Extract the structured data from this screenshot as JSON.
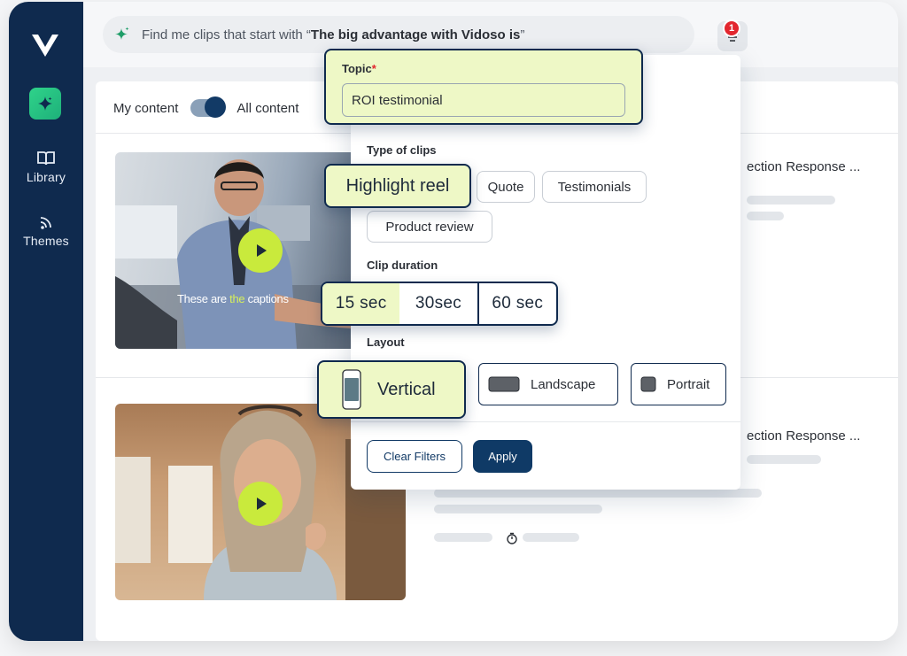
{
  "sidebar": {
    "items": [
      {
        "label": "Library",
        "icon": "book-icon"
      },
      {
        "label": "Themes",
        "icon": "rss-icon"
      }
    ]
  },
  "search": {
    "prefix": "Find me clips that start with “",
    "bold": "The big advantage with Vidoso is",
    "suffix": "”"
  },
  "notifications": {
    "count": "1"
  },
  "content_toggle": {
    "left_label": "My content",
    "right_label": "All content",
    "selected": "All content"
  },
  "rows": [
    {
      "title": "ection Response ...",
      "caption_pre": "These are ",
      "caption_hl": "the",
      "caption_post": " captions"
    },
    {
      "title": "ection Response ..."
    }
  ],
  "filters": {
    "topic": {
      "label": "Topic",
      "required_mark": "*",
      "value": "ROI testimonial"
    },
    "type_of_clips": {
      "label": "Type of clips",
      "options": [
        "Highlight reel",
        "Quote",
        "Testimonials",
        "Product review"
      ],
      "selected": "Highlight reel"
    },
    "clip_duration": {
      "label": "Clip duration",
      "options": [
        "15 sec",
        "30sec",
        "60 sec"
      ],
      "selected": "15 sec"
    },
    "layout": {
      "label": "Layout",
      "options": [
        "Vertical",
        "Landscape",
        "Portrait"
      ],
      "selected": "Vertical"
    },
    "clear_label": "Clear Filters",
    "apply_label": "Apply"
  },
  "colors": {
    "sidebar": "#0f2a4e",
    "highlight": "#eef8c6",
    "accent_green": "#c9ea3c",
    "badge_red": "#e2262e",
    "primary_button": "#0f3a66"
  }
}
